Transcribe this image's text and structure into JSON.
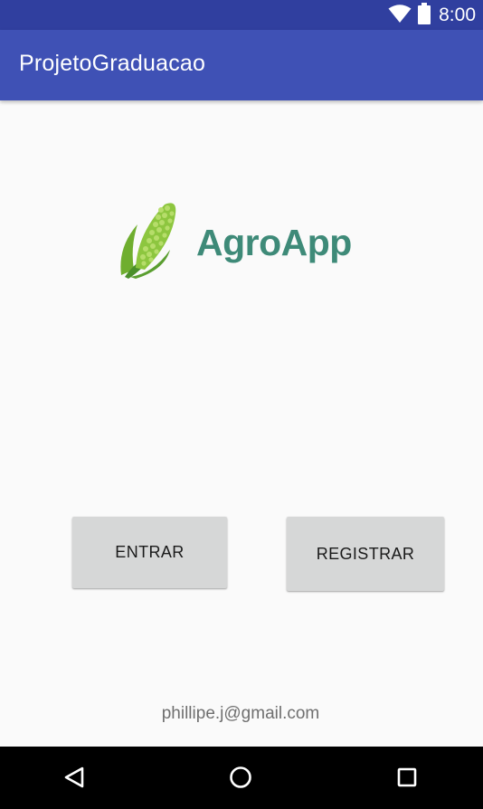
{
  "status_bar": {
    "time": "8:00",
    "icons": [
      "wifi-icon",
      "battery-icon"
    ]
  },
  "app_bar": {
    "title": "ProjetoGraduacao"
  },
  "logo": {
    "text": "AgroApp",
    "icon": "corn-icon",
    "colors": {
      "text": "#3e8a78",
      "corn_light": "#8dc63f",
      "corn_dark": "#4a8f2a"
    }
  },
  "buttons": {
    "entrar": "ENTRAR",
    "registrar": "REGISTRAR"
  },
  "footer": {
    "email": "phillipe.j@gmail.com"
  },
  "nav_bar": {
    "icons": [
      "back-icon",
      "home-icon",
      "recents-icon"
    ]
  },
  "colors": {
    "primary": "#3f51b5",
    "primary_dark": "#303f9f",
    "background": "#fafafa",
    "button": "#d6d7d7"
  }
}
